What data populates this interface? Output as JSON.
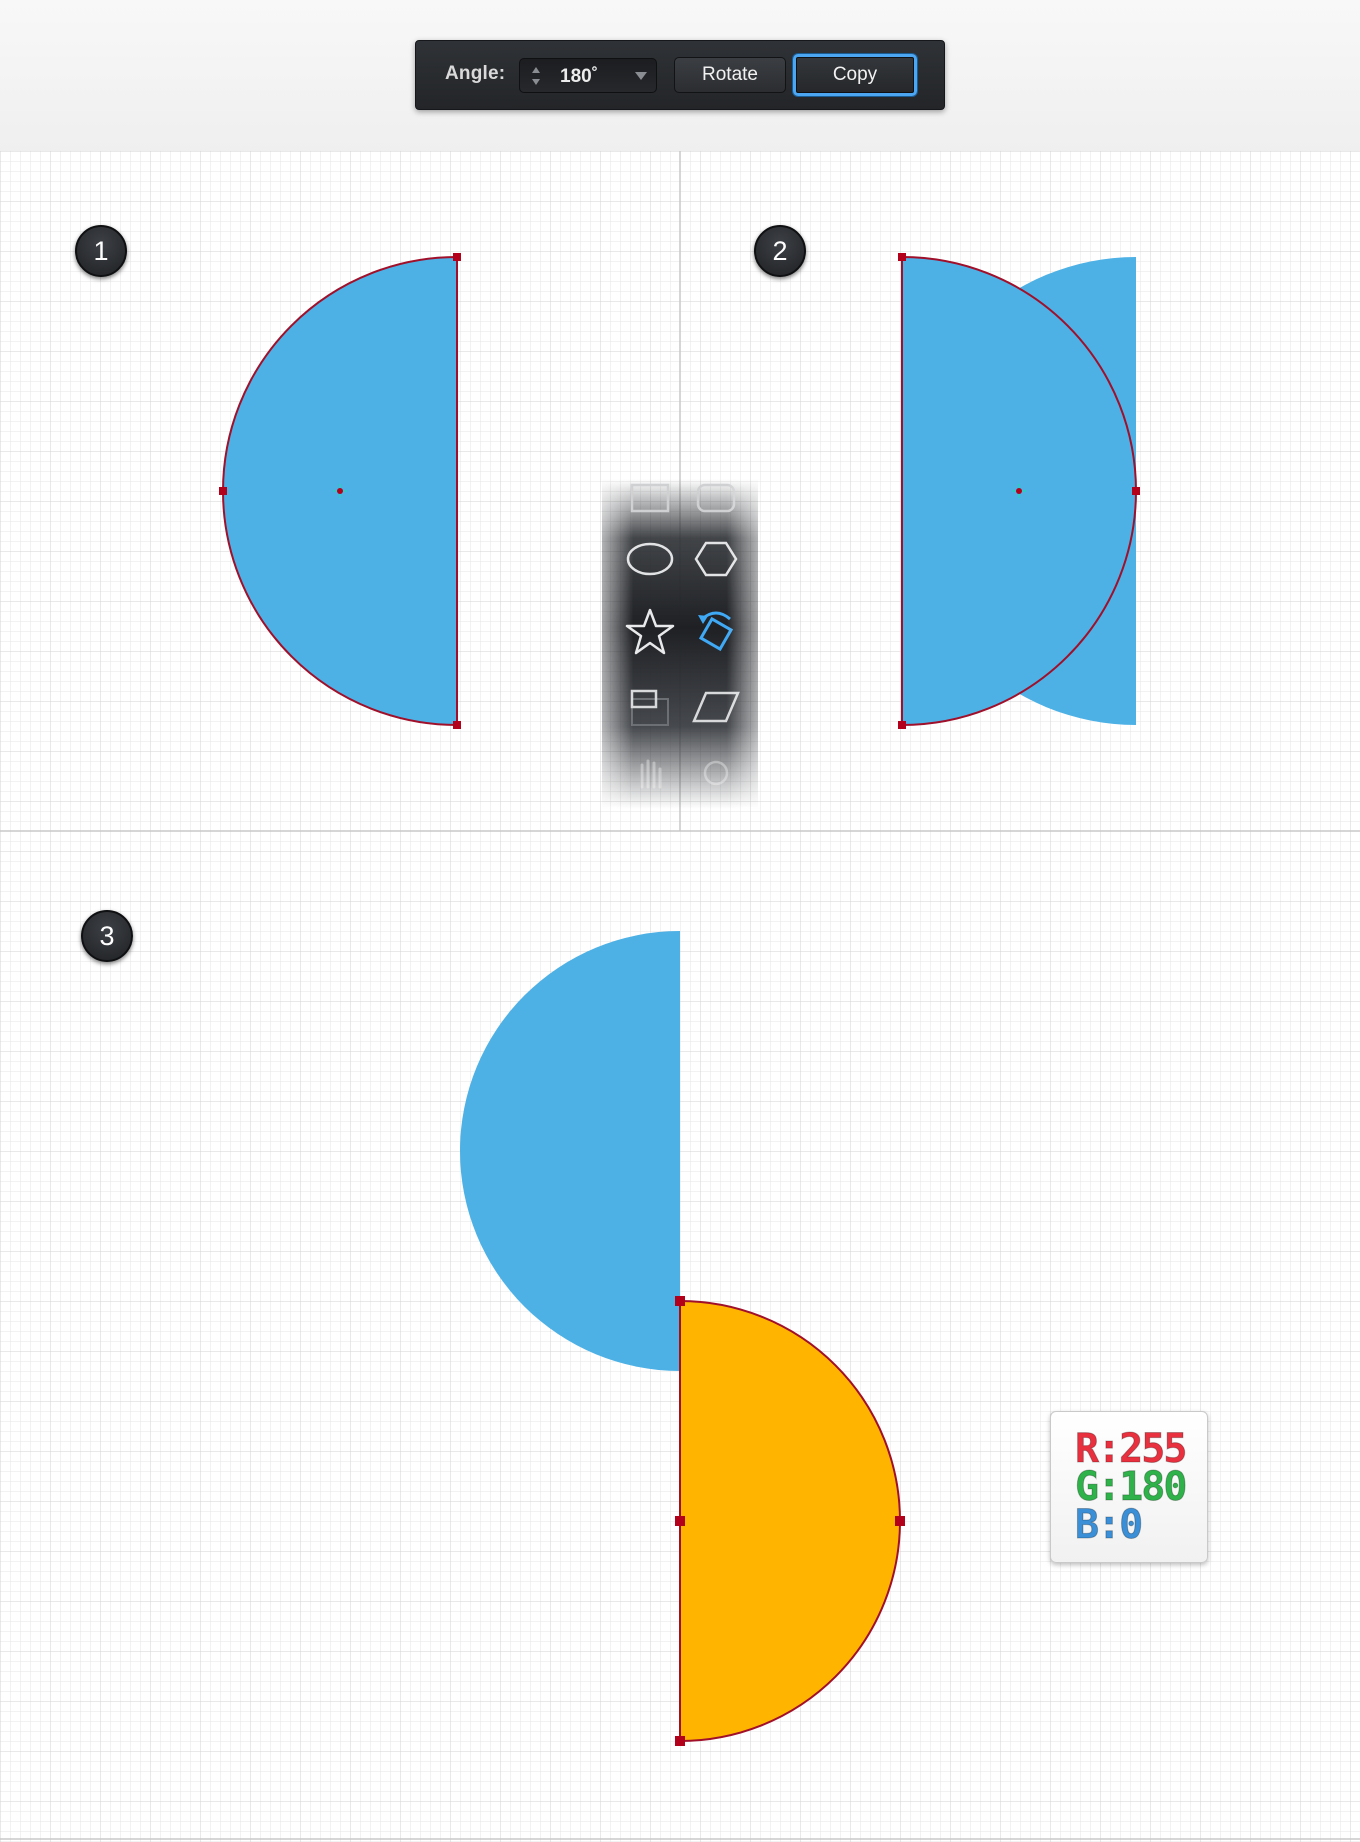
{
  "toolbar": {
    "angle_label": "Angle:",
    "angle_value": "180˚",
    "rotate_label": "Rotate",
    "copy_label": "Copy"
  },
  "steps": [
    "1",
    "2",
    "3"
  ],
  "tool_palette": {
    "icons": [
      "rectangle-icon",
      "rounded-rectangle-icon",
      "ellipse-icon",
      "polygon-icon",
      "star-icon",
      "rotate-tool-icon",
      "scale-tool-icon",
      "shear-tool-icon",
      "hand-tool-icon",
      "zoom-tool-icon"
    ],
    "selected": "rotate-tool-icon"
  },
  "color_card": {
    "r_text": "R:255",
    "g_text": "G:180",
    "b_text": "B:0"
  },
  "colors": {
    "shape_blue": "#4db1e6",
    "shape_orange": "#ffb400",
    "selection_red": "#a0102a",
    "accent_blue": "#4da6f2",
    "r_color": "#e8303e",
    "g_color": "#2fb24a",
    "b_color": "#3a8fd6"
  }
}
